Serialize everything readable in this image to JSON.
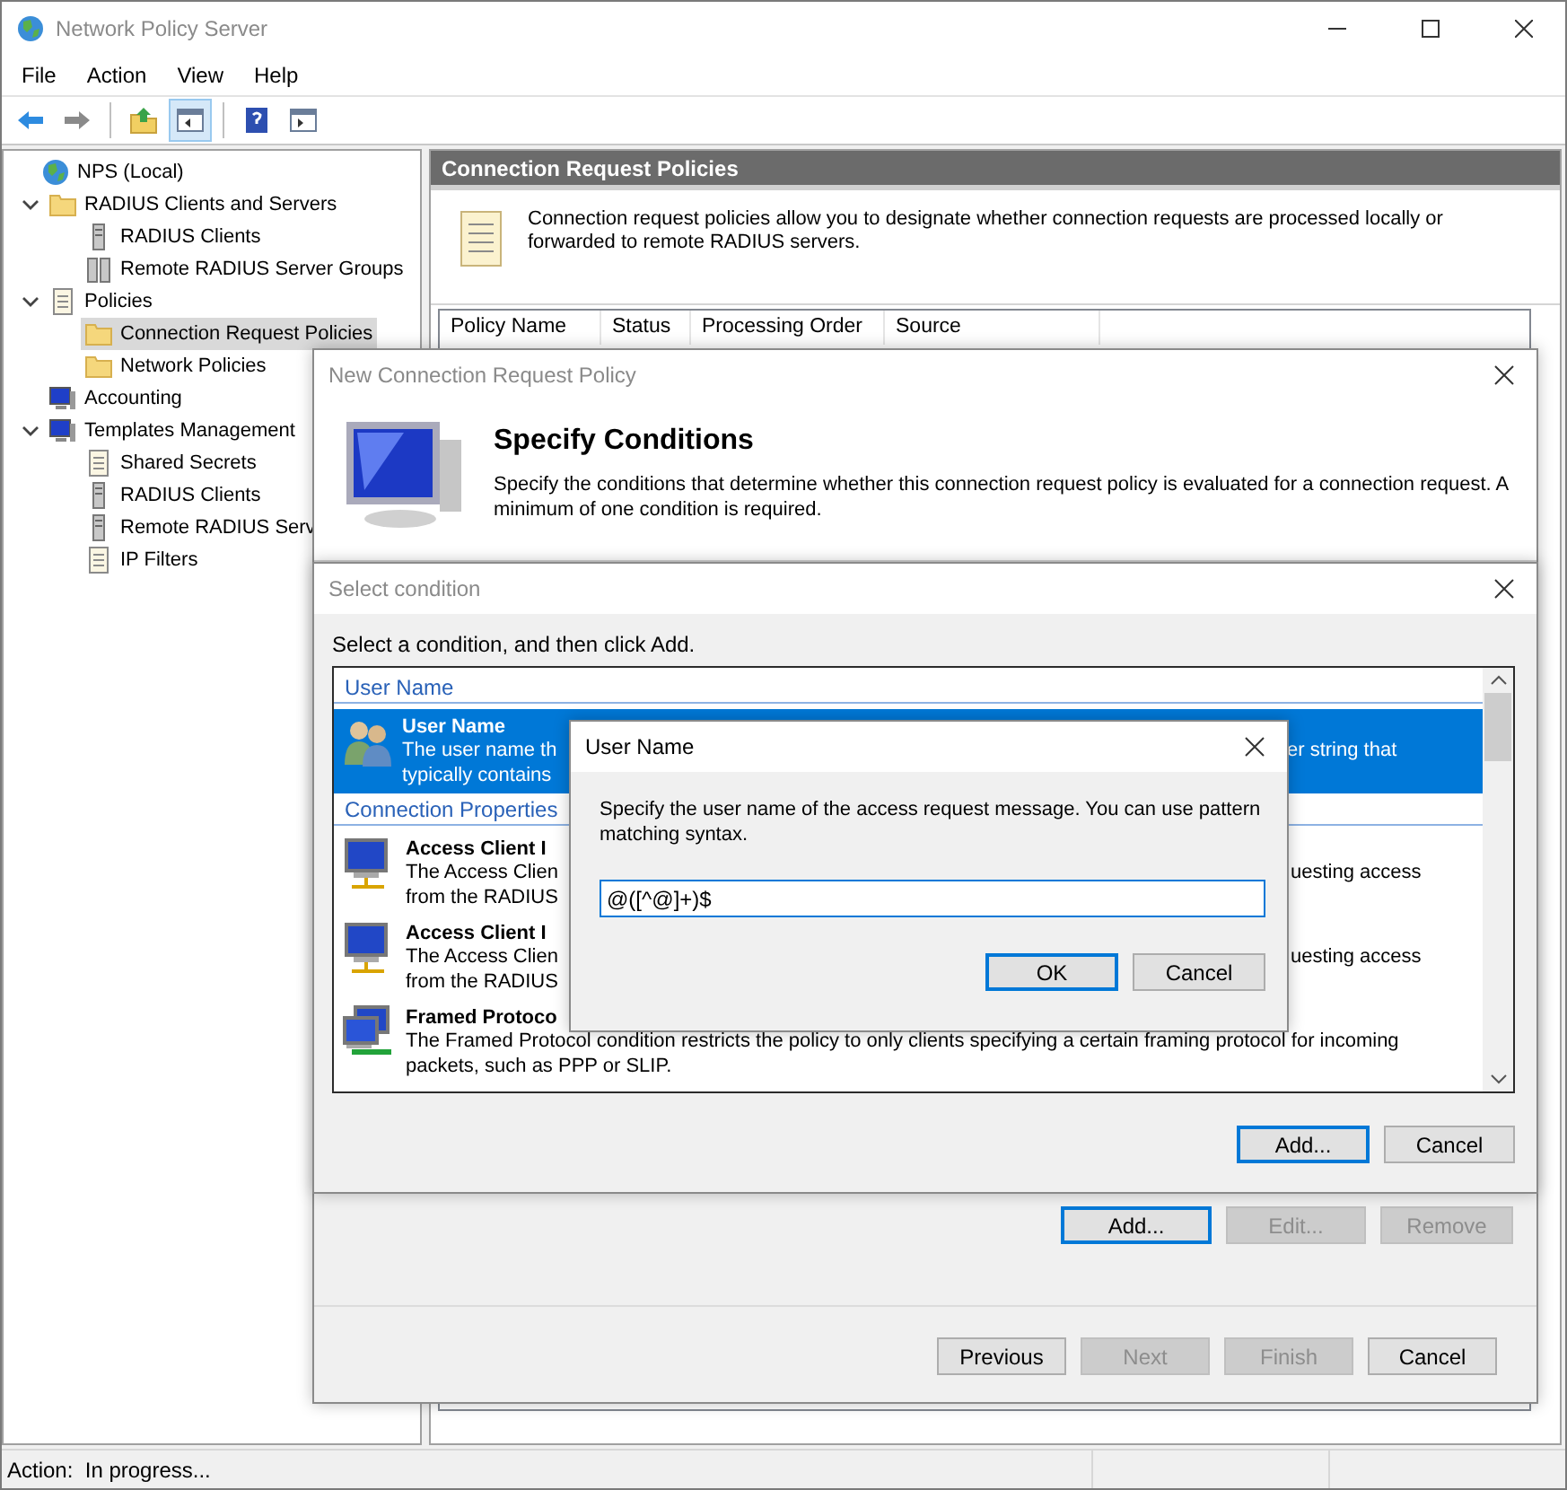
{
  "window": {
    "title": "Network Policy Server"
  },
  "menu": [
    "File",
    "Action",
    "View",
    "Help"
  ],
  "toolbar": [
    {
      "selected": false
    },
    {
      "selected": false
    },
    {
      "selected": false
    },
    {
      "selected": true
    },
    {
      "selected": false
    },
    {
      "selected": false
    }
  ],
  "tree": [
    {
      "label": "NPS (Local)",
      "kind": "globe",
      "selected": false,
      "children": [
        {
          "label": "RADIUS Clients and Servers",
          "kind": "folder",
          "selected": false,
          "expanded": true,
          "children": [
            {
              "label": "RADIUS Clients",
              "kind": "server",
              "selected": false
            },
            {
              "label": "Remote RADIUS Server Groups",
              "kind": "servers",
              "selected": false
            }
          ]
        },
        {
          "label": "Policies",
          "kind": "document",
          "selected": false,
          "expanded": true,
          "children": [
            {
              "label": "Connection Request Policies",
              "kind": "folder",
              "selected": true
            },
            {
              "label": "Network Policies",
              "kind": "folder",
              "selected": false
            }
          ]
        },
        {
          "label": "Accounting",
          "kind": "monitor",
          "selected": false
        },
        {
          "label": "Templates Management",
          "kind": "monitor",
          "selected": false,
          "expanded": true,
          "children": [
            {
              "label": "Shared Secrets",
              "kind": "document",
              "selected": false
            },
            {
              "label": "RADIUS Clients",
              "kind": "server",
              "selected": false
            },
            {
              "label": "Remote RADIUS Serv",
              "kind": "server",
              "selected": false
            },
            {
              "label": "IP Filters",
              "kind": "document",
              "selected": false
            }
          ]
        }
      ]
    }
  ],
  "pane": {
    "title": "Connection Request Policies",
    "info": "Connection request policies allow you to designate whether connection requests are processed locally or forwarded to remote RADIUS servers.",
    "columns": [
      "Policy Name",
      "Status",
      "Processing Order",
      "Source"
    ]
  },
  "status_bar": "Action:  In progress...",
  "wizard": {
    "title": "New Connection Request Policy",
    "heading": "Specify Conditions",
    "description": "Specify the conditions that determine whether this connection request policy is evaluated for a connection request. A minimum of one condition is required.",
    "buttons": [
      {
        "label": "Add...",
        "disabled": false,
        "default": true
      },
      {
        "label": "Edit...",
        "disabled": true,
        "default": false
      },
      {
        "label": "Remove",
        "disabled": true,
        "default": false
      }
    ],
    "nav_buttons": [
      {
        "label": "Previous",
        "disabled": false
      },
      {
        "label": "Next",
        "disabled": true
      },
      {
        "label": "Finish",
        "disabled": true
      },
      {
        "label": "Cancel",
        "disabled": false
      }
    ]
  },
  "select_condition": {
    "title": "Select condition",
    "prompt": "Select a condition, and then click Add.",
    "list": [
      {
        "kind": "group",
        "label": "User Name"
      },
      {
        "kind": "user",
        "title": "User Name",
        "selected": true,
        "lines": [
          {
            "left": "The user name th",
            "right": "er string that"
          },
          {
            "left": "typically contains"
          }
        ]
      },
      {
        "kind": "group",
        "label": "Connection Properties"
      },
      {
        "kind": "client",
        "title": "Access Client I",
        "selected": false,
        "lines": [
          {
            "left": "The Access Clien",
            "right": "uesting access"
          },
          {
            "left": "from the RADIUS"
          }
        ]
      },
      {
        "kind": "client",
        "title": "Access Client I",
        "selected": false,
        "lines": [
          {
            "left": "The Access Clien",
            "right": "uesting access"
          },
          {
            "left": "from the RADIUS"
          }
        ]
      },
      {
        "kind": "protocol",
        "title": "Framed Protoco",
        "selected": false,
        "lines": [
          {
            "left": "The Framed Protocol condition restricts the policy to only clients specifying a certain framing protocol for incoming"
          },
          {
            "left": "packets, such as PPP or SLIP."
          }
        ]
      }
    ],
    "buttons": [
      {
        "label": "Add...",
        "default": true
      },
      {
        "label": "Cancel",
        "default": false
      }
    ]
  },
  "user_name_dialog": {
    "title": "User Name",
    "prompt": "Specify the user name of the access request message. You can use pattern matching syntax.",
    "value": "@([^@]+)$",
    "buttons": [
      {
        "label": "OK",
        "default": true
      },
      {
        "label": "Cancel",
        "default": false
      }
    ]
  }
}
